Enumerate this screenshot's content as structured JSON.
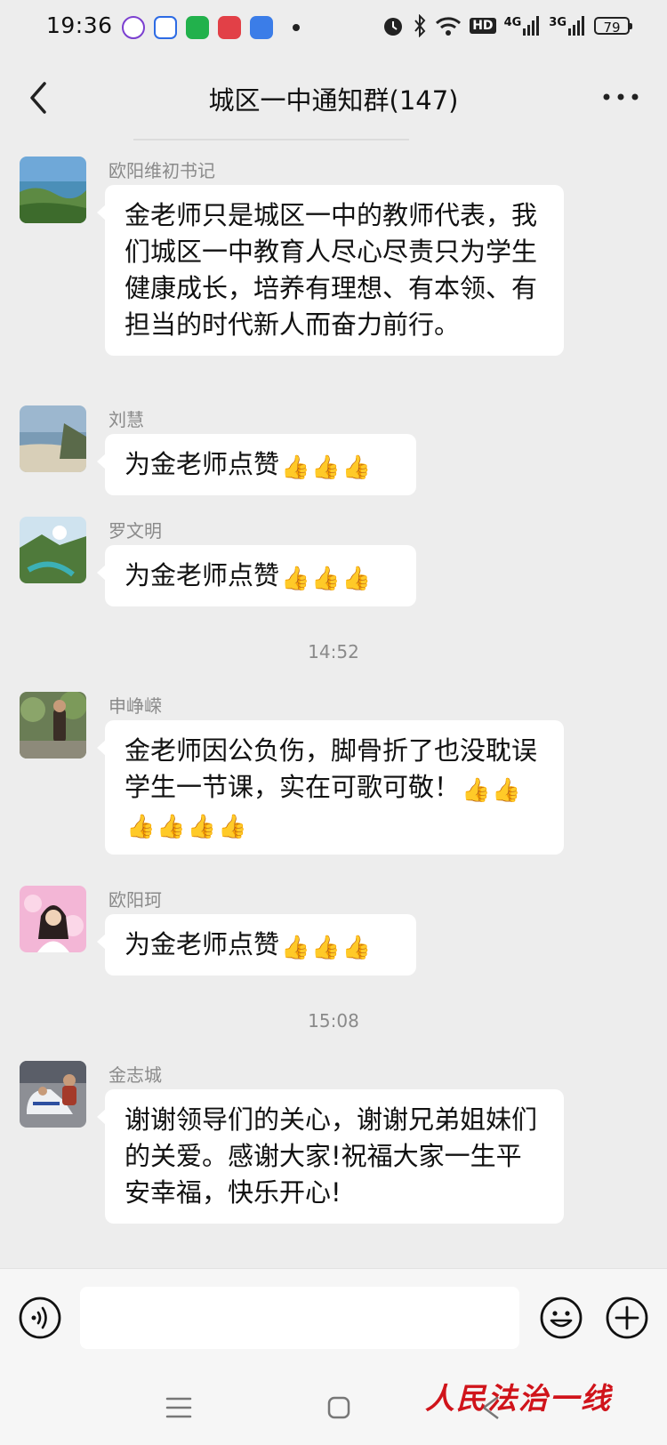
{
  "status_bar": {
    "time": "19:36",
    "battery": "79",
    "network_labels": [
      "HD",
      "4G",
      "3G"
    ]
  },
  "header": {
    "title": "城区一中通知群(147)"
  },
  "messages": [
    {
      "sender": "欧阳维初书记",
      "text": "金老师只是城区一中的教师代表，我们城区一中教育人尽心尽责只为学生健康成长，培养有理想、有本领、有担当的时代新人而奋力前行。",
      "thumbs": 0
    },
    {
      "sender": "刘慧",
      "text": "为金老师点赞",
      "thumbs": 3
    },
    {
      "sender": "罗文明",
      "text": "为金老师点赞",
      "thumbs": 3
    },
    {
      "sender": "申峥嵘",
      "text": "金老师因公负伤，脚骨折了也没耽误学生一节课，实在可歌可敬！",
      "thumbs": 6
    },
    {
      "sender": "欧阳珂",
      "text": "为金老师点赞",
      "thumbs": 3
    },
    {
      "sender": "金志城",
      "text": "谢谢领导们的关心，谢谢兄弟姐妹们的关爱。感谢大家!祝福大家一生平安幸福，快乐开心!",
      "thumbs": 0
    }
  ],
  "timestamps": [
    "14:52",
    "15:08"
  ],
  "input": {
    "value": "",
    "placeholder": ""
  },
  "watermark": "人民法治一线",
  "icons": {
    "back": "chevron-left-icon",
    "more": "more-dots-icon",
    "voice": "voice-icon",
    "emoji": "emoji-icon",
    "plus": "plus-icon",
    "thumb": "thumbs-up-emoji"
  },
  "colors": {
    "background": "#ededed",
    "bubble": "#ffffff",
    "watermark": "#d0141b"
  }
}
